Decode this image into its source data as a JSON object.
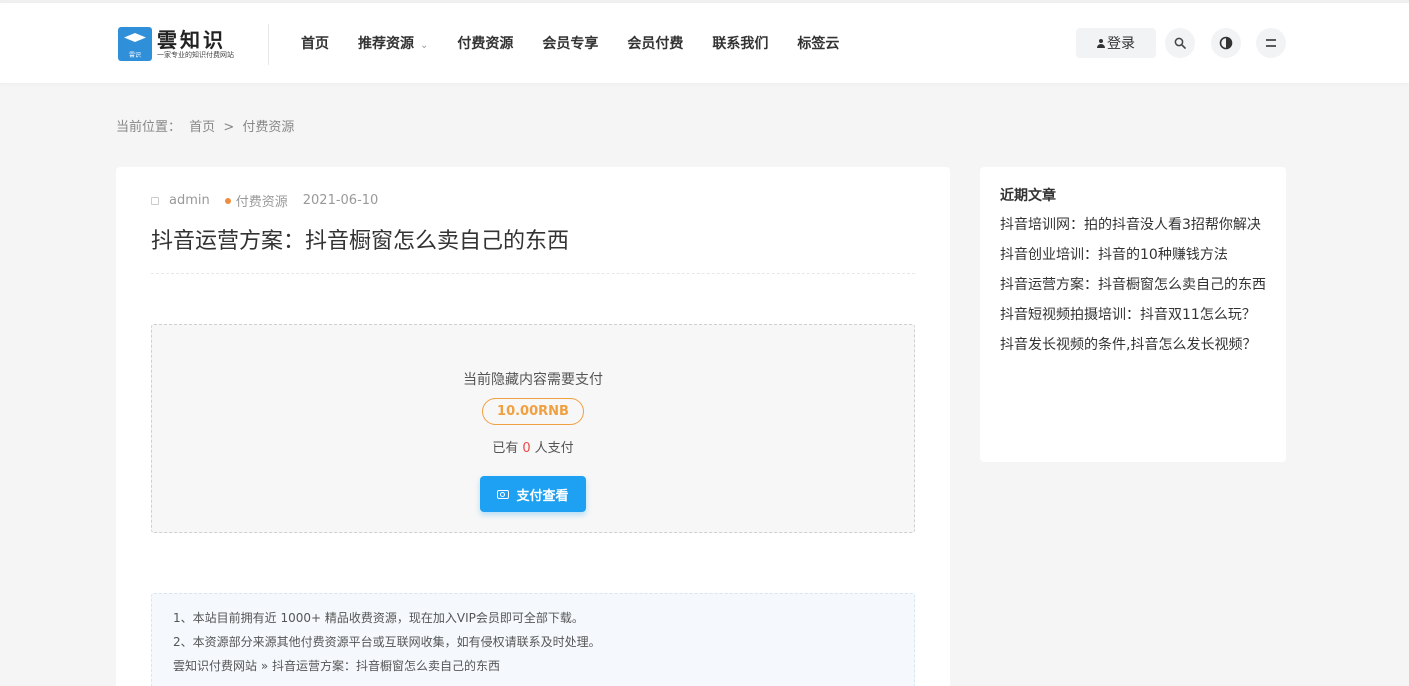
{
  "header": {
    "logo": {
      "title": "雲知识",
      "subtitle": "一家专业的知识付费网站",
      "badge_text": "雲识"
    },
    "nav": [
      {
        "label": "首页"
      },
      {
        "label": "推荐资源",
        "has_dropdown": true
      },
      {
        "label": "付费资源"
      },
      {
        "label": "会员专享"
      },
      {
        "label": "会员付费"
      },
      {
        "label": "联系我们"
      },
      {
        "label": "标签云"
      }
    ],
    "login_label": "登录",
    "icons": [
      "search-icon",
      "theme-toggle-icon",
      "menu-icon"
    ]
  },
  "breadcrumb": {
    "prefix": "当前位置：",
    "home": "首页",
    "sep": ">",
    "current": "付费资源"
  },
  "article": {
    "author": "admin",
    "category": "付费资源",
    "date": "2021-06-10",
    "title": "抖音运营方案：抖音橱窗怎么卖自己的东西"
  },
  "paywall": {
    "hint": "当前隐藏内容需要支付",
    "price": "10.00RNB",
    "paid_prefix": "已有",
    "paid_count": "0",
    "paid_suffix": "人支付",
    "button_label": "支付查看"
  },
  "notice": {
    "lines": [
      "1、本站目前拥有近 1000+ 精品收费资源，现在加入VIP会员即可全部下载。",
      "2、本资源部分来源其他付费资源平台或互联网收集，如有侵权请联系及时处理。",
      "雲知识付费网站 » 抖音运营方案：抖音橱窗怎么卖自己的东西"
    ]
  },
  "sidebar": {
    "title": "近期文章",
    "items": [
      {
        "label": "抖音培训网：拍的抖音没人看3招帮你解决"
      },
      {
        "label": "抖音创业培训：抖音的10种赚钱方法"
      },
      {
        "label": "抖音运营方案：抖音橱窗怎么卖自己的东西"
      },
      {
        "label": "抖音短视频拍摄培训：抖音双11怎么玩？"
      },
      {
        "label": "抖音发长视频的条件,抖音怎么发长视频？"
      }
    ]
  },
  "colors": {
    "accent": "#1ea1f2",
    "price": "#f0a040",
    "paid_count": "#e84a4a"
  }
}
